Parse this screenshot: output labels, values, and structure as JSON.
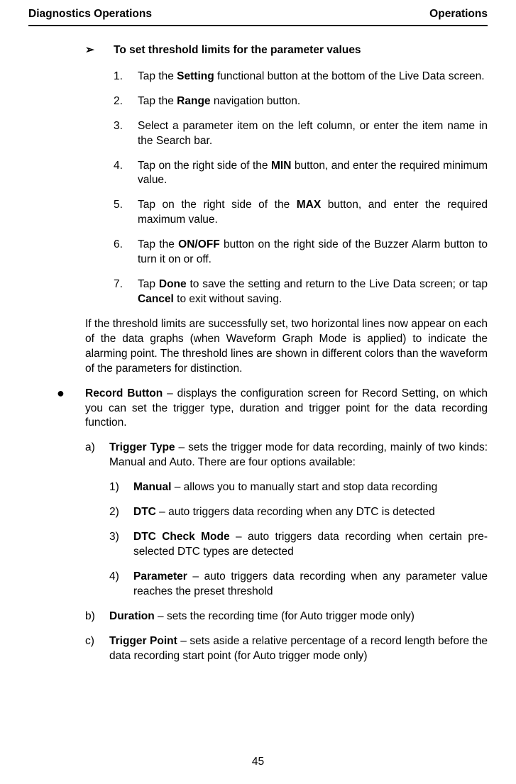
{
  "header": {
    "left": "Diagnostics Operations",
    "right": "Operations"
  },
  "arrow": {
    "mark": "➢",
    "title": "To set threshold limits for the parameter values"
  },
  "steps": {
    "s1": {
      "n": "1.",
      "pre": "Tap the ",
      "bold": "Setting",
      "post": " functional button at the bottom of the Live Data screen."
    },
    "s2": {
      "n": "2.",
      "pre": "Tap the ",
      "bold": "Range",
      "post": " navigation button."
    },
    "s3": {
      "n": "3.",
      "text": "Select a parameter item on the left column, or enter the item name in the Search bar."
    },
    "s4": {
      "n": "4.",
      "pre": "Tap on the right side of the ",
      "bold": "MIN",
      "post": " button, and enter the required minimum value."
    },
    "s5": {
      "n": "5.",
      "pre": "Tap on the right side of the ",
      "bold": "MAX",
      "post": " button, and enter the required maximum value."
    },
    "s6": {
      "n": "6.",
      "pre": "Tap the ",
      "bold": "ON/OFF",
      "post": " button on the right side of the Buzzer Alarm button to turn it on or off."
    },
    "s7": {
      "n": "7.",
      "pre": "Tap ",
      "bold1": "Done",
      "mid": " to save the setting and return to the Live Data screen; or tap ",
      "bold2": "Cancel",
      "post": " to exit without saving."
    }
  },
  "threshold_para": "If the threshold limits are successfully set, two horizontal lines now appear on each of the data graphs (when Waveform Graph Mode is applied) to indicate the alarming point. The threshold lines are shown in different colors than the waveform of the parameters for distinction.",
  "record_bullet": {
    "mark": "●",
    "bold": "Record Button",
    "text": " – displays the configuration screen for Record Setting, on which you can set the trigger type, duration and trigger point for the data recording function."
  },
  "alpha": {
    "a": {
      "n": "a)",
      "bold": "Trigger Type",
      "text": " – sets the trigger mode for data recording, mainly of two kinds: Manual and Auto. There are four options available:"
    },
    "b": {
      "n": "b)",
      "bold": "Duration",
      "text": " – sets the recording time (for Auto trigger mode only)"
    },
    "c": {
      "n": "c)",
      "bold": "Trigger Point",
      "text": " – sets aside a relative percentage of a record length before the data recording start point (for Auto trigger mode only)"
    }
  },
  "trigger_opts": {
    "o1": {
      "n": "1)",
      "bold": "Manual",
      "text": " – allows you to manually start and stop data recording"
    },
    "o2": {
      "n": "2)",
      "bold": "DTC",
      "text": " – auto triggers data recording when any DTC is detected"
    },
    "o3": {
      "n": "3)",
      "bold": "DTC Check Mode",
      "text": " – auto triggers data recording when certain pre-selected DTC types are detected"
    },
    "o4": {
      "n": "4)",
      "bold": "Parameter",
      "text": " – auto triggers data recording when any parameter value reaches the preset threshold"
    }
  },
  "page_number": "45"
}
